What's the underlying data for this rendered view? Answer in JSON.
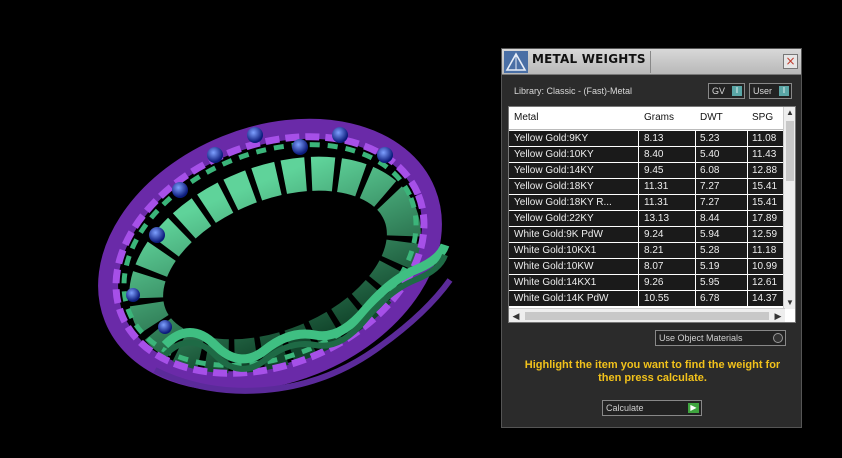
{
  "window": {
    "title": "METAL WEIGHTS",
    "close_label": "×"
  },
  "library": {
    "label": "Library: Classic - (Fast)-Metal"
  },
  "toggles": {
    "gv_label": "GV",
    "user_label": "User",
    "indicator": "I"
  },
  "table": {
    "columns": [
      "Metal",
      "Grams",
      "DWT",
      "SPG"
    ],
    "rows": [
      [
        "Yellow Gold:9KY",
        "8.13",
        "5.23",
        "11.08"
      ],
      [
        "Yellow Gold:10KY",
        "8.40",
        "5.40",
        "11.43"
      ],
      [
        "Yellow Gold:14KY",
        "9.45",
        "6.08",
        "12.88"
      ],
      [
        "Yellow Gold:18KY",
        "11.31",
        "7.27",
        "15.41"
      ],
      [
        "Yellow Gold:18KY R...",
        "11.31",
        "7.27",
        "15.41"
      ],
      [
        "Yellow Gold:22KY",
        "13.13",
        "8.44",
        "17.89"
      ],
      [
        "White Gold:9K PdW",
        "9.24",
        "5.94",
        "12.59"
      ],
      [
        "White Gold:10KX1",
        "8.21",
        "5.28",
        "11.18"
      ],
      [
        "White Gold:10KW",
        "8.07",
        "5.19",
        "10.99"
      ],
      [
        "White Gold:14KX1",
        "9.26",
        "5.95",
        "12.61"
      ],
      [
        "White Gold:14K PdW",
        "10.55",
        "6.78",
        "14.37"
      ]
    ]
  },
  "use_object_materials": {
    "label": "Use Object Materials"
  },
  "hint": {
    "text": "Highlight the item you want to find the weight for then press calculate."
  },
  "calculate": {
    "label": "Calculate",
    "go_icon": "▶"
  },
  "colors": {
    "ring_purple": "#7d2fc4",
    "ring_green": "#2f8f5c",
    "ring_blue": "#2238c8",
    "hint_yellow": "#f2c21b",
    "indicator_teal": "#5aa6a6",
    "go_green": "#3fa53f"
  }
}
